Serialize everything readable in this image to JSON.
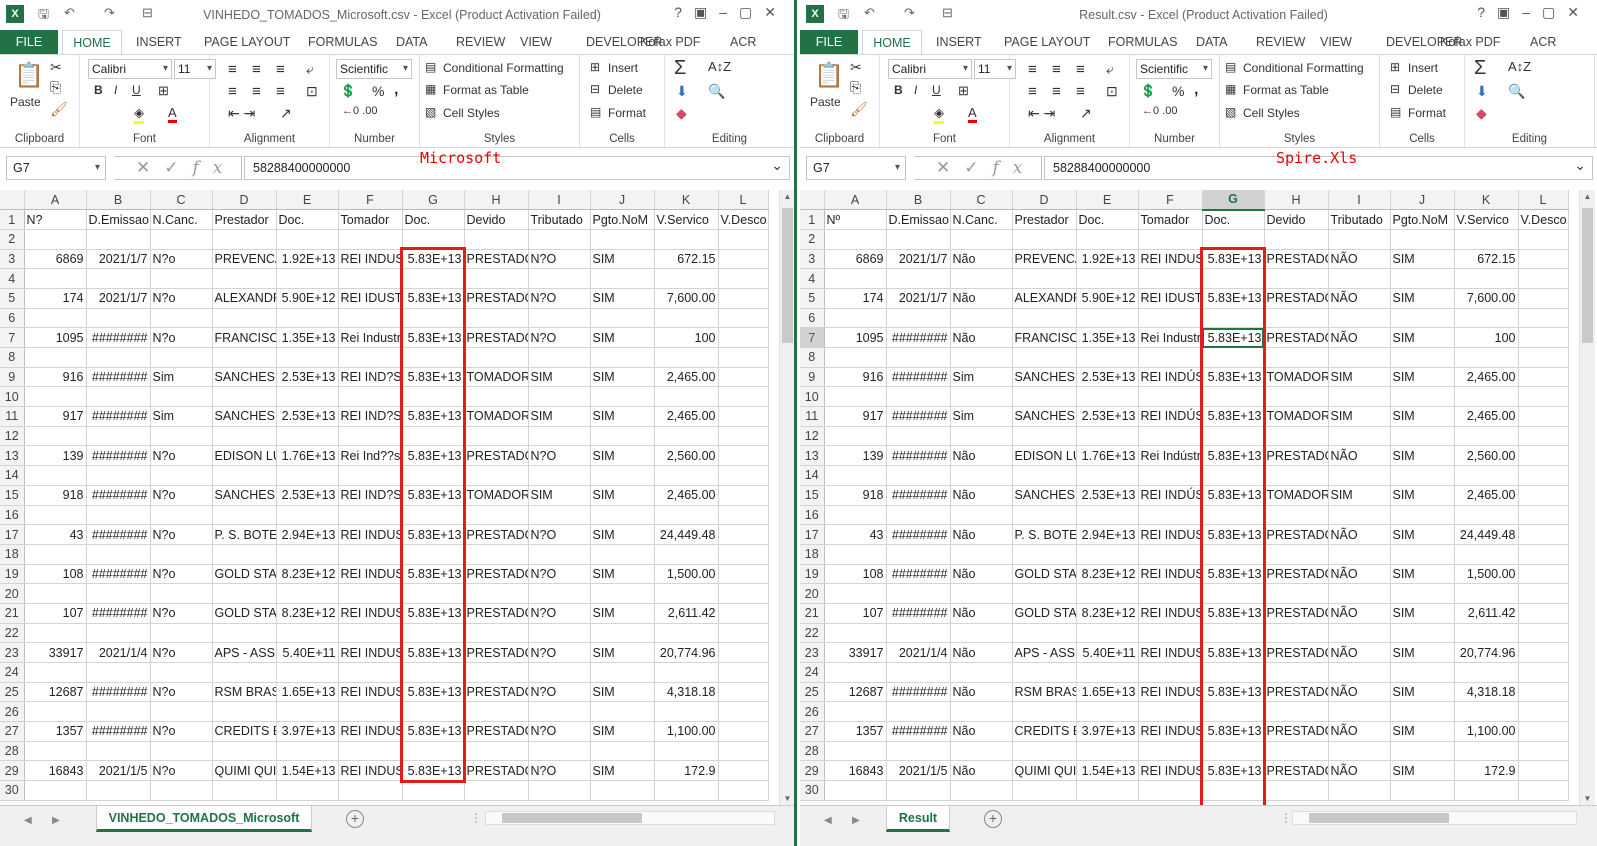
{
  "left": {
    "title": "VINHEDO_TOMADOS_Microsoft.csv - Excel (Product Activation Failed)",
    "annotation": "Microsoft",
    "name_box": "G7",
    "formula": "58288400000000",
    "sheet_tab": "VINHEDO_TOMADOS_Microsoft",
    "headers": [
      "N?",
      "D.Emissao",
      "N.Canc.",
      "Prestador",
      "Doc.",
      "Tomador",
      "Doc.",
      "Devido",
      "Tributado",
      "Pgto.NoM",
      "V.Servico",
      "V.Desco"
    ],
    "rows": [
      [
        "6869",
        "2021/1/7",
        "N?o",
        "PREVENCAO",
        "1.92E+13",
        "REI INDUSTRIA",
        "5.83E+13",
        "PRESTADOR",
        "N?O",
        "SIM",
        "672.15",
        ""
      ],
      [
        "174",
        "2021/1/7",
        "N?o",
        "ALEXANDRE",
        "5.90E+12",
        "REI IDUSTRIA",
        "5.83E+13",
        "PRESTADOR",
        "N?O",
        "SIM",
        "7,600.00",
        ""
      ],
      [
        "1095",
        "########",
        "N?o",
        "FRANCISCO",
        "1.35E+13",
        "Rei Industria",
        "5.83E+13",
        "PRESTADOR",
        "N?O",
        "SIM",
        "100",
        ""
      ],
      [
        "916",
        "########",
        "Sim",
        "SANCHES",
        "2.53E+13",
        "REI IND?STRIA",
        "5.83E+13",
        "TOMADOR",
        "SIM",
        "SIM",
        "2,465.00",
        ""
      ],
      [
        "917",
        "########",
        "Sim",
        "SANCHES",
        "2.53E+13",
        "REI IND?STRIA",
        "5.83E+13",
        "TOMADOR",
        "SIM",
        "SIM",
        "2,465.00",
        ""
      ],
      [
        "139",
        "########",
        "N?o",
        "EDISON LUIZ",
        "1.76E+13",
        "Rei Ind??stria",
        "5.83E+13",
        "PRESTADOR",
        "N?O",
        "SIM",
        "2,560.00",
        ""
      ],
      [
        "918",
        "########",
        "N?o",
        "SANCHES",
        "2.53E+13",
        "REI IND?STRIA",
        "5.83E+13",
        "TOMADOR",
        "SIM",
        "SIM",
        "2,465.00",
        ""
      ],
      [
        "43",
        "########",
        "N?o",
        "P. S. BOTELHO",
        "2.94E+13",
        "REI INDUSTRIA",
        "5.83E+13",
        "PRESTADOR",
        "N?O",
        "SIM",
        "24,449.48",
        ""
      ],
      [
        "108",
        "########",
        "N?o",
        "GOLD STAR",
        "8.23E+12",
        "REI INDUSTRIA",
        "5.83E+13",
        "PRESTADOR",
        "N?O",
        "SIM",
        "1,500.00",
        ""
      ],
      [
        "107",
        "########",
        "N?o",
        "GOLD STAR",
        "8.23E+12",
        "REI INDUSTRIA",
        "5.83E+13",
        "PRESTADOR",
        "N?O",
        "SIM",
        "2,611.42",
        ""
      ],
      [
        "33917",
        "2021/1/4",
        "N?o",
        "APS - ASSI",
        "5.40E+11",
        "REI INDUSTRIA",
        "5.83E+13",
        "PRESTADOR",
        "N?O",
        "SIM",
        "20,774.96",
        ""
      ],
      [
        "12687",
        "########",
        "N?o",
        "RSM BRASIL",
        "1.65E+13",
        "REI INDUSTRIA",
        "5.83E+13",
        "PRESTADOR",
        "N?O",
        "SIM",
        "4,318.18",
        ""
      ],
      [
        "1357",
        "########",
        "N?o",
        "CREDITS BR",
        "3.97E+13",
        "REI INDUSTRIA",
        "5.83E+13",
        "PRESTADOR",
        "N?O",
        "SIM",
        "1,100.00",
        ""
      ],
      [
        "16843",
        "2021/1/5",
        "N?o",
        "QUIMI QUIM",
        "1.54E+13",
        "REI INDUSTRIA",
        "5.83E+13",
        "PRESTADOR",
        "N?O",
        "SIM",
        "172.9",
        ""
      ]
    ]
  },
  "right": {
    "title": "Result.csv - Excel (Product Activation Failed)",
    "annotation": "Spire.Xls",
    "name_box": "G7",
    "formula": "58288400000000",
    "sheet_tab": "Result",
    "headers": [
      "Nº",
      "D.Emissao",
      "N.Canc.",
      "Prestador",
      "Doc.",
      "Tomador",
      "Doc.",
      "Devido",
      "Tributado",
      "Pgto.NoM",
      "V.Servico",
      "V.Desco"
    ],
    "rows": [
      [
        "6869",
        "2021/1/7",
        "Não",
        "PREVENCAO",
        "1.92E+13",
        "REI INDUSTRIA",
        "5.83E+13",
        "PRESTADOR",
        "NÃO",
        "SIM",
        "672.15",
        ""
      ],
      [
        "174",
        "2021/1/7",
        "Não",
        "ALEXANDRE",
        "5.90E+12",
        "REI IDUSTRIA",
        "5.83E+13",
        "PRESTADOR",
        "NÃO",
        "SIM",
        "7,600.00",
        ""
      ],
      [
        "1095",
        "########",
        "Não",
        "FRANCISCO",
        "1.35E+13",
        "Rei Industria",
        "5.83E+13",
        "PRESTADOR",
        "NÃO",
        "SIM",
        "100",
        ""
      ],
      [
        "916",
        "########",
        "Sim",
        "SANCHES",
        "2.53E+13",
        "REI INDÚSTRIA",
        "5.83E+13",
        "TOMADOR",
        "SIM",
        "SIM",
        "2,465.00",
        ""
      ],
      [
        "917",
        "########",
        "Sim",
        "SANCHES",
        "2.53E+13",
        "REI INDÚSTRIA",
        "5.83E+13",
        "TOMADOR",
        "SIM",
        "SIM",
        "2,465.00",
        ""
      ],
      [
        "139",
        "########",
        "Não",
        "EDISON LUIZ",
        "1.76E+13",
        "Rei Indústria",
        "5.83E+13",
        "PRESTADOR",
        "NÃO",
        "SIM",
        "2,560.00",
        ""
      ],
      [
        "918",
        "########",
        "Não",
        "SANCHES",
        "2.53E+13",
        "REI INDÚSTRIA",
        "5.83E+13",
        "TOMADOR",
        "SIM",
        "SIM",
        "2,465.00",
        ""
      ],
      [
        "43",
        "########",
        "Não",
        "P. S. BOTELHO",
        "2.94E+13",
        "REI INDUSTRIA",
        "5.83E+13",
        "PRESTADOR",
        "NÃO",
        "SIM",
        "24,449.48",
        ""
      ],
      [
        "108",
        "########",
        "Não",
        "GOLD STAR",
        "8.23E+12",
        "REI INDUSTRIA",
        "5.83E+13",
        "PRESTADOR",
        "NÃO",
        "SIM",
        "1,500.00",
        ""
      ],
      [
        "107",
        "########",
        "Não",
        "GOLD STAR",
        "8.23E+12",
        "REI INDUSTRIA",
        "5.83E+13",
        "PRESTADOR",
        "NÃO",
        "SIM",
        "2,611.42",
        ""
      ],
      [
        "33917",
        "2021/1/4",
        "Não",
        "APS - ASSI",
        "5.40E+11",
        "REI INDUSTRIA",
        "5.83E+13",
        "PRESTADOR",
        "NÃO",
        "SIM",
        "20,774.96",
        ""
      ],
      [
        "12687",
        "########",
        "Não",
        "RSM BRASIL",
        "1.65E+13",
        "REI INDUSTRIA",
        "5.83E+13",
        "PRESTADOR",
        "NÃO",
        "SIM",
        "4,318.18",
        ""
      ],
      [
        "1357",
        "########",
        "Não",
        "CREDITS BR",
        "3.97E+13",
        "REI INDUSTRIA",
        "5.83E+13",
        "PRESTADOR",
        "NÃO",
        "SIM",
        "1,100.00",
        ""
      ],
      [
        "16843",
        "2021/1/5",
        "Não",
        "QUIMI QUIM",
        "1.54E+13",
        "REI INDUSTRIA",
        "5.83E+13",
        "PRESTADOR",
        "NÃO",
        "SIM",
        "172.9",
        ""
      ]
    ]
  },
  "col_letters": [
    "A",
    "B",
    "C",
    "D",
    "E",
    "F",
    "G",
    "H",
    "I",
    "J",
    "K",
    "L"
  ],
  "row_count": 30,
  "ribbon": {
    "tabs": [
      "FILE",
      "HOME",
      "INSERT",
      "PAGE LAYOUT",
      "FORMULAS",
      "DATA",
      "REVIEW",
      "VIEW",
      "DEVELOPER",
      "Kofax PDF",
      "ACR"
    ],
    "groups": [
      "Clipboard",
      "Font",
      "Alignment",
      "Number",
      "Styles",
      "Cells",
      "Editing"
    ],
    "paste": "Paste",
    "font_name": "Calibri",
    "font_size": "11",
    "number_format": "Scientific",
    "conditional_formatting": "Conditional Formatting",
    "format_as_table": "Format as Table",
    "cell_styles": "Cell Styles",
    "insert": "Insert",
    "delete": "Delete",
    "format": "Format",
    "bold": "B",
    "italic": "I",
    "underline": "U",
    "fx": "fx",
    "percent": "%",
    "comma": ","
  },
  "colors": {
    "excel_green": "#217346",
    "highlight_red": "#e21b1b"
  }
}
